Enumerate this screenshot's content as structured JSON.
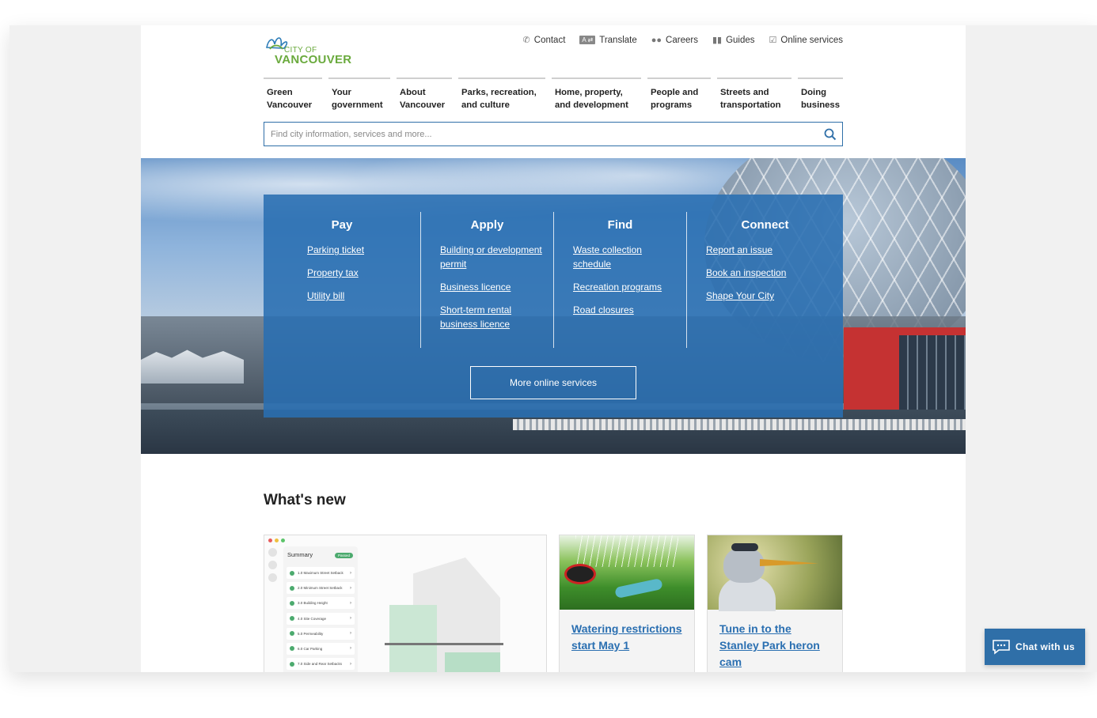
{
  "header": {
    "logo_line1": "CITY OF",
    "logo_line2": "VANCOUVER",
    "utility": [
      {
        "label": "Contact",
        "icon": "phone-icon"
      },
      {
        "label": "Translate",
        "icon": "translate-icon",
        "badge": "A ⇄"
      },
      {
        "label": "Careers",
        "icon": "people-icon"
      },
      {
        "label": "Guides",
        "icon": "book-icon"
      },
      {
        "label": "Online services",
        "icon": "checkbox-icon"
      }
    ],
    "nav": [
      {
        "line1": "Green",
        "line2": "Vancouver"
      },
      {
        "line1": "Your",
        "line2": "government"
      },
      {
        "line1": "About",
        "line2": "Vancouver"
      },
      {
        "line1": "Parks, recreation,",
        "line2": "and culture"
      },
      {
        "line1": "Home, property,",
        "line2": "and development"
      },
      {
        "line1": "People and",
        "line2": "programs"
      },
      {
        "line1": "Streets and",
        "line2": "transportation"
      },
      {
        "line1": "Doing",
        "line2": "business"
      }
    ],
    "search_placeholder": "Find city information, services and more..."
  },
  "hero": {
    "columns": [
      {
        "title": "Pay",
        "links": [
          "Parking ticket",
          "Property tax",
          "Utility bill"
        ]
      },
      {
        "title": "Apply",
        "links": [
          "Building or development permit",
          "Business licence",
          "Short-term rental business licence"
        ]
      },
      {
        "title": "Find",
        "links": [
          "Waste collection schedule",
          "Recreation programs",
          "Road closures"
        ]
      },
      {
        "title": "Connect",
        "links": [
          "Report an issue",
          "Book an inspection",
          "Shape Your City"
        ]
      }
    ],
    "more_button": "More online services"
  },
  "whats_new": {
    "title": "What's new",
    "feature": {
      "summary_title": "Summary",
      "summary_badge": "Passed",
      "rows": [
        "1.0 Maximum Street Setback",
        "2.0 Minimum Street Setback",
        "3.0 Building Height",
        "4.0 Site Coverage",
        "5.0 Permeability",
        "6.0 Car Parking",
        "7.0 Side and Rear Setbacks"
      ]
    },
    "cards": [
      {
        "title": "Watering restrictions start May 1"
      },
      {
        "title": "Tune in to the Stanley Park heron cam"
      }
    ]
  },
  "chat": {
    "label": "Chat with us"
  },
  "colors": {
    "brand_blue": "#2f6fa8",
    "logo_green": "#6aaa3d",
    "link_blue": "#2a6fb1"
  }
}
